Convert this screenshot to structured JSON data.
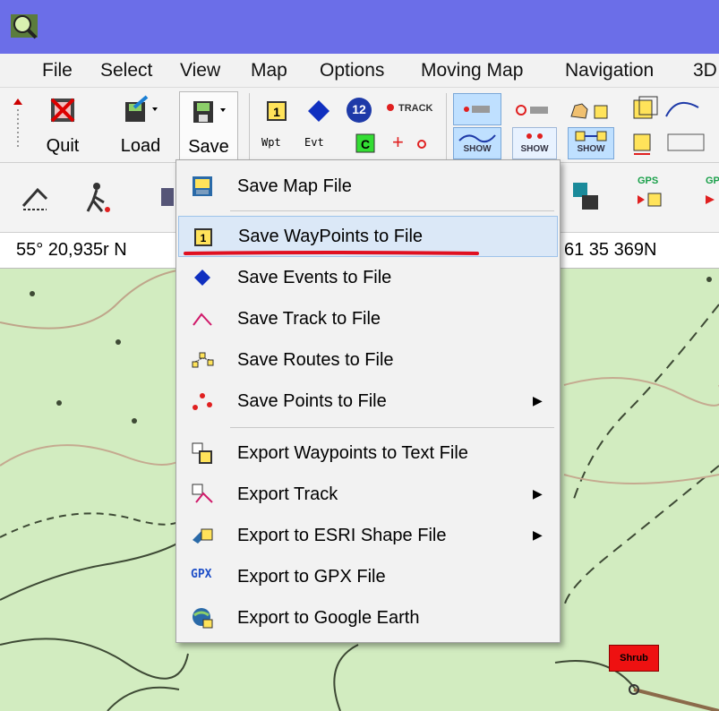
{
  "menubar": {
    "items": [
      "File",
      "Select",
      "View",
      "Map",
      "Options",
      "Moving Map",
      "Navigation",
      "3D"
    ]
  },
  "toolbar": {
    "quit_label": "Quit",
    "load_label": "Load",
    "save_label": "Save",
    "wpt_label": "Wpt",
    "evt_label": "Evt",
    "track_label": "TRACK",
    "show_label": "SHOW",
    "gps_label": "GPS",
    "waypoint_number": "12"
  },
  "coordinates": {
    "lat": "55° 20,935r N",
    "right": "61 35 369N"
  },
  "save_menu": {
    "items": [
      {
        "label": "Save Map File",
        "icon": "map-file-icon",
        "submenu": false
      },
      {
        "label": "Save WayPoints to File",
        "icon": "waypoint-icon",
        "submenu": false,
        "highlighted": true
      },
      {
        "label": "Save Events to File",
        "icon": "event-diamond-icon",
        "submenu": false
      },
      {
        "label": "Save Track to File",
        "icon": "track-icon",
        "submenu": false
      },
      {
        "label": "Save Routes to File",
        "icon": "routes-icon",
        "submenu": false
      },
      {
        "label": "Save Points to File",
        "icon": "points-icon",
        "submenu": true
      },
      {
        "label": "Export Waypoints to Text File",
        "icon": "export-waypoints-icon",
        "submenu": false
      },
      {
        "label": "Export Track",
        "icon": "export-track-icon",
        "submenu": true
      },
      {
        "label": "Export to ESRI Shape File",
        "icon": "esri-shape-icon",
        "submenu": true
      },
      {
        "label": "Export to GPX File",
        "icon": "gpx-icon",
        "submenu": false
      },
      {
        "label": "Export to Google Earth",
        "icon": "google-earth-icon",
        "submenu": false
      }
    ],
    "gpx_icon_text": "GPX"
  },
  "map": {
    "label_shrub": "Shrub"
  },
  "colors": {
    "titlebar": "#6b6ee8",
    "highlight": "#dbe8f7",
    "annotation_underline": "#e01020",
    "map_bg": "#d2ecc0"
  }
}
